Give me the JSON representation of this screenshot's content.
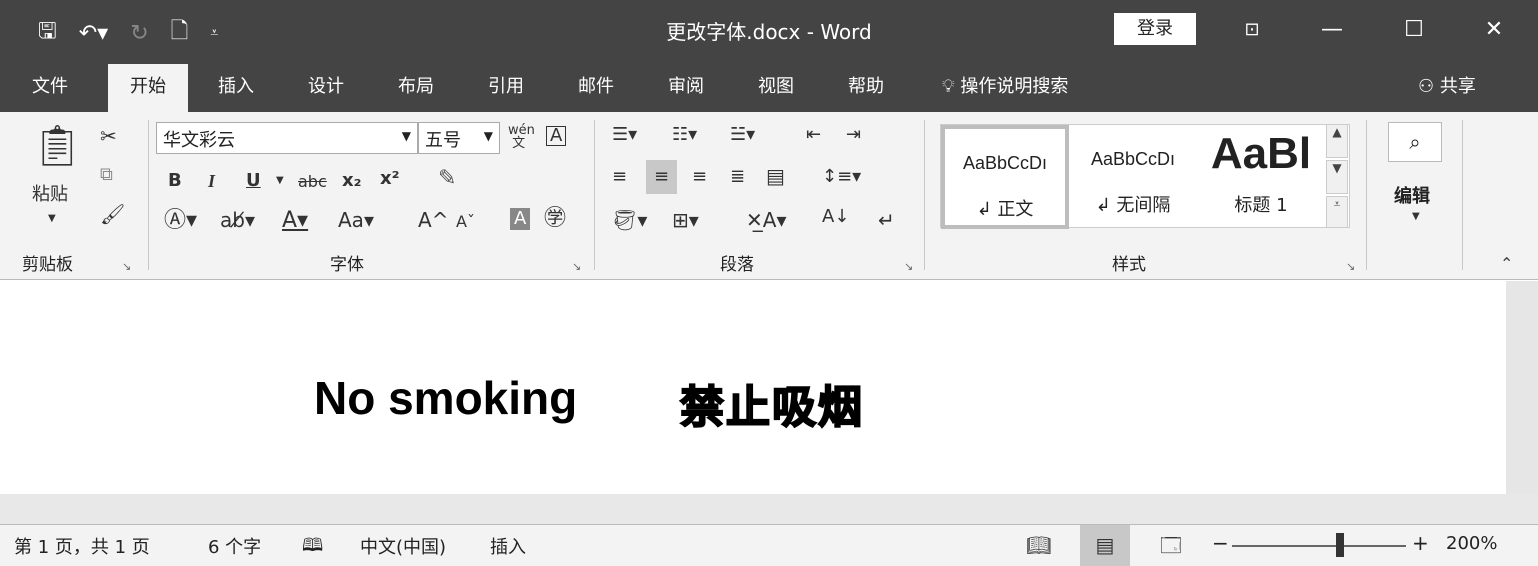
{
  "app": {
    "doc_title": "更改字体.docx  -  Word",
    "login_label": "登录"
  },
  "qat": {
    "save_icon": "save-icon",
    "undo_icon": "undo-icon",
    "redo_icon": "redo-icon",
    "new_icon": "new-document-icon",
    "customize_icon": "customize-qat-icon"
  },
  "window": {
    "ribbon_display_icon": "ribbon-display-icon",
    "minimize": "—",
    "restore": "☐",
    "close": "✕"
  },
  "tabs": [
    "文件",
    "开始",
    "插入",
    "设计",
    "布局",
    "引用",
    "邮件",
    "审阅",
    "视图",
    "帮助"
  ],
  "active_tab": "开始",
  "tellme": "操作说明搜索",
  "share": "共享",
  "clipboard": {
    "paste_label": "粘贴",
    "group_label": "剪贴板"
  },
  "font": {
    "font_name": "华文彩云",
    "font_size": "五号",
    "group_label": "字体",
    "bold": "B",
    "italic": "I",
    "underline": "U",
    "strike": "abc",
    "sub": "x₂",
    "sup": "x²",
    "case": "Aa",
    "grow": "A",
    "shrink": "A",
    "wen": "wén\n文"
  },
  "paragraph": {
    "group_label": "段落"
  },
  "styles": {
    "group_label": "样式",
    "items": [
      {
        "preview": "AaBbCcDı",
        "name": "↲ 正文"
      },
      {
        "preview": "AaBbCcDı",
        "name": "↲ 无间隔"
      },
      {
        "preview": "AaBl",
        "name": "标题 1"
      }
    ]
  },
  "editing": {
    "label": "编辑"
  },
  "document": {
    "english_text": "No smoking",
    "chinese_text": "禁止吸烟"
  },
  "statusbar": {
    "page": "第 1 页，共 1 页",
    "words": "6 个字",
    "language": "中文(中国)",
    "mode": "插入",
    "zoom": "200%"
  }
}
